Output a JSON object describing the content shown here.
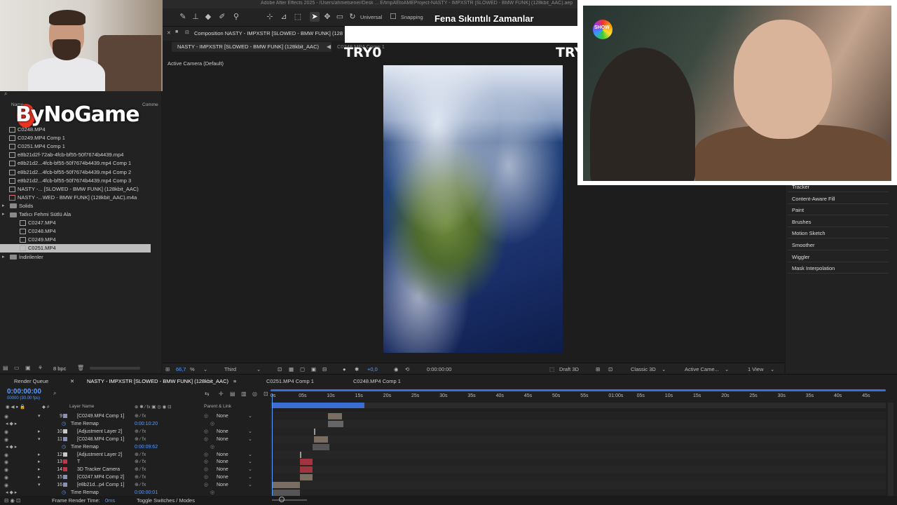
{
  "window": {
    "title": "Adobe After Effects 2025 - /Users/ahmetsener/Desk ... E/tmpAEtoAMEProject-NASTY - IMPXSTR [SLOWED - BMW FUNK] (128kbit_AAC).aep"
  },
  "toolbar": {
    "universal_label": "Universal",
    "snapping_label": "Snapping"
  },
  "overlay": {
    "show_title": "Fena Sıkıntılı Zamanlar",
    "brand_text": "ByNoGame",
    "try_left": "TRY0",
    "try_right": "TRY",
    "tv_logo": "SHOW"
  },
  "project_panel": {
    "search_placeholder": "",
    "col_name": "Name",
    "col_comment": "Comme",
    "items": [
      {
        "label": "C0248.MP4",
        "type": "file",
        "indent": 0
      },
      {
        "label": "C0249.MP4 Comp 1",
        "type": "comp",
        "indent": 0
      },
      {
        "label": "C0251.MP4 Comp 1",
        "type": "comp",
        "indent": 0
      },
      {
        "label": "e8b21d2f-72ab-4fcb-bf55-50f7674b4439.mp4",
        "type": "file",
        "indent": 0
      },
      {
        "label": "e8b21d2...4fcb-bf55-50f7674b4439.mp4 Comp 1",
        "type": "comp",
        "indent": 0
      },
      {
        "label": "e8b21d2...4fcb-bf55-50f7674b4439.mp4 Comp 2",
        "type": "comp",
        "indent": 0
      },
      {
        "label": "e8b21d2...4fcb-bf55-50f7674b4439.mp4 Comp 3",
        "type": "comp",
        "indent": 0
      },
      {
        "label": "NASTY -... [SLOWED - BMW FUNK] (128kbit_AAC)",
        "type": "comp",
        "indent": 0
      },
      {
        "label": "NASTY -...WED - BMW FUNK] (128kbit_AAC).m4a",
        "type": "audio",
        "indent": 0
      },
      {
        "label": "Solids",
        "type": "folder",
        "indent": 0
      },
      {
        "label": "Tatlıcı Fehmi Sütlü Ala",
        "type": "folder",
        "indent": 0
      },
      {
        "label": "C0247.MP4",
        "type": "file",
        "indent": 1
      },
      {
        "label": "C0248.MP4",
        "type": "file",
        "indent": 1
      },
      {
        "label": "C0249.MP4",
        "type": "file",
        "indent": 1
      },
      {
        "label": "C0251.MP4",
        "type": "file",
        "indent": 1,
        "selected": true
      },
      {
        "label": "İndirilenler",
        "type": "folder",
        "indent": 0
      }
    ],
    "bpc": "8 bpc"
  },
  "composition": {
    "panel_tab": "Composition NASTY - IMPXSTR [SLOWED - BMW FUNK] (128",
    "sub_tab": "NASTY - IMPXSTR [SLOWED - BMW FUNK] (128kbit_AAC)",
    "sub_tab2": "C0248.MP4 Comp 1",
    "active_camera": "Active Camera (Default)"
  },
  "viewer_bar": {
    "zoom": "66,7",
    "zoom_unit": "%",
    "resolution": "Third",
    "exposure": "+0,0",
    "timecode": "0:00:00:00",
    "renderer": "Draft 3D",
    "classic": "Classic 3D",
    "camera": "Active Came...",
    "views": "1 View"
  },
  "right_panel": {
    "items": [
      "Tracker",
      "Content-Aware Fill",
      "Paint",
      "Brushes",
      "Motion Sketch",
      "Smoother",
      "Wiggler",
      "Mask Interpolation"
    ]
  },
  "timeline": {
    "tabs": [
      {
        "label": "Render Queue"
      },
      {
        "label": "NASTY - IMPXSTR [SLOWED - BMW FUNK] (128kbit_AAC)"
      },
      {
        "label": "C0251.MP4 Comp 1"
      },
      {
        "label": "C0248.MP4 Comp 1"
      }
    ],
    "current_time": "0:00:00:00",
    "current_time_sub": "00000 (30.00 fps)",
    "col_layer_name": "Layer Name",
    "col_parent": "Parent & Link",
    "ruler": [
      "0s",
      "05s",
      "10s",
      "15s",
      "20s",
      "25s",
      "30s",
      "35s",
      "40s",
      "45s",
      "50s",
      "55s",
      "01:00s",
      "05s",
      "10s",
      "15s",
      "20s",
      "25s",
      "30s",
      "35s",
      "40s",
      "45s"
    ],
    "layers": [
      {
        "num": "9",
        "name": "[C0249.MP4 Comp 1]",
        "parent": "None",
        "color": "#8a8fb5"
      },
      {
        "sub": "Time Remap",
        "value": "0:00:10:20"
      },
      {
        "num": "10",
        "name": "[Adjustment Layer 2]",
        "parent": "None",
        "color": "#c9c9c9"
      },
      {
        "num": "11",
        "name": "[C0248.MP4 Comp 1]",
        "parent": "None",
        "color": "#8a8fb5"
      },
      {
        "sub": "Time Remap",
        "value": "0:00:09:62"
      },
      {
        "num": "12",
        "name": "[Adjustment Layer 2]",
        "parent": "None",
        "color": "#c9c9c9"
      },
      {
        "num": "13",
        "name": "T",
        "parent": "None",
        "color": "#c0354a"
      },
      {
        "num": "14",
        "name": "3D Tracker Camera",
        "parent": "None",
        "color": "#c0354a"
      },
      {
        "num": "15",
        "name": "[C0247.MP4 Comp 2]",
        "parent": "None",
        "color": "#8a8fb5"
      },
      {
        "num": "16",
        "name": "[e8b21d...p4 Comp 1]",
        "parent": "None",
        "color": "#8a8fb5"
      },
      {
        "sub": "Time Remap",
        "value": "0:00:00:01"
      }
    ],
    "frame_render_label": "Frame Render Time:",
    "frame_render_value": "0ms",
    "toggle_label": "Toggle Switches / Modes"
  },
  "colors": {
    "accent_blue": "#5b9cff",
    "work_area": "#3a6fd6",
    "selected_row": "#bdbdbd"
  }
}
